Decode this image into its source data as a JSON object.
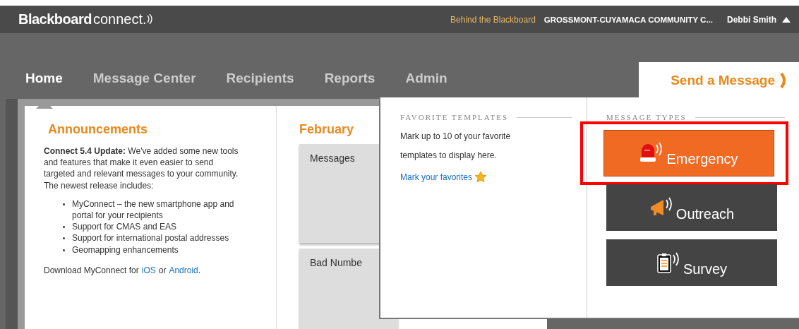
{
  "header": {
    "logo_bold": "Blackboard",
    "logo_light": "connect.",
    "link": "Behind the Blackboard",
    "organization": "GROSSMONT-CUYAMACA COMMUNITY C...",
    "user": "Debbi Smith"
  },
  "nav": [
    {
      "label": "Home",
      "selected": true
    },
    {
      "label": "Message Center",
      "selected": false
    },
    {
      "label": "Recipients",
      "selected": false
    },
    {
      "label": "Reports",
      "selected": false
    },
    {
      "label": "Admin",
      "selected": false
    }
  ],
  "send_tab": {
    "label": "Send a Message"
  },
  "announcements": {
    "title": "Announcements",
    "intro": "**Connect 5.4 Update:** We've added some new tools and features that make it even easier to send targeted and relevant messages to your community. The newest release includes:",
    "items": [
      "MyConnect – the new smartphone app and portal for your recipients",
      "Support for CMAS and EAS",
      "Support for international postal addresses",
      "Geomapping enhancements"
    ],
    "download_text": "Download MyConnect for",
    "ios_link": "iOS",
    "or_text": "or",
    "android_link": "Android",
    "end_text": "."
  },
  "calendar": {
    "title": "February",
    "cards": [
      "Messages",
      "Bad Numbe"
    ]
  },
  "dropdown": {
    "favorites_heading": "FAVORITE TEMPLATES",
    "favorites_text": "Mark up to 10 of your favorite templates to display here.",
    "favorites_link": "Mark your favorites",
    "types_heading": "MESSAGE TYPES",
    "types": [
      {
        "kind": "emergency",
        "label": "Emergency",
        "selected": true
      },
      {
        "kind": "outreach",
        "label": "Outreach",
        "selected": false
      },
      {
        "kind": "survey",
        "label": "Survey",
        "selected": false
      }
    ]
  }
}
